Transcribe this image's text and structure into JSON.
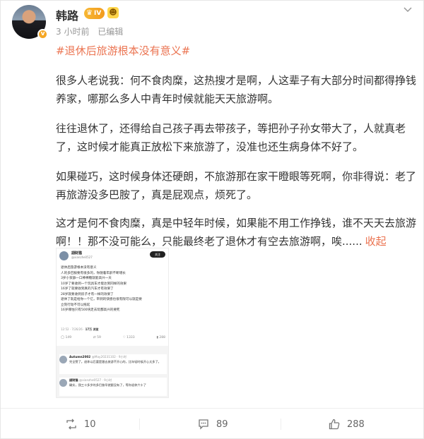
{
  "post": {
    "author": "韩路",
    "vip_level": "IV",
    "time": "3 小时前",
    "edited": "已编辑",
    "topic": "#退休后旅游根本没有意义#",
    "paragraphs": [
      "很多人老说我：何不食肉糜，这热搜才是啊，人这辈子有大部分时间都得挣钱养家，哪那么多人中青年时候就能天天旅游啊。",
      "往往退休了，还得给自己孩子再去带孩子，等把孙子孙女带大了，人就真老了，这时候才能真正放松下来旅游了，没准也还生病身体不好了。",
      "如果碰巧，这时候身体还硬朗，不旅游那在家干瞪眼等死啊，你非得说：老了再旅游没多巴胺了，真是屁观点，烦死了。",
      "这才是何不食肉糜，真是中轻年时候，如果能不用工作挣钱，谁不天天去旅游啊！！那不没可能么，只能最终老了退休才有空去旅游啊，唉......"
    ],
    "collapse_label": "收起"
  },
  "screenshot": {
    "name": "翃财猫",
    "handle": "@xianzhe0527",
    "follow": "关注",
    "lines": [
      "退休后旅游根本没有意义",
      "人的多巴胺要有很多的，你随着年龄不断增长",
      "3岁小孩舔一口棒棒糖就能高兴一天",
      "10岁了要收到一个玩具车才能达到同样的效果",
      "16岁了就要收到真的汽车才有效果了",
      "28岁就要收到房子才有一样的效果了",
      "退休了就是给你一个亿，带到的快感也很有限可以就是要",
      "立刻行动不可以拖延",
      "16岁哪怕只有500块走去玩都高兴的要死"
    ],
    "stats": "12:52 · 7/26/26",
    "views": "17万 浏览",
    "actions": [
      "149",
      "59",
      "1333",
      "288"
    ],
    "replies": [
      {
        "name": "Autumn2002",
        "handle": "@May20231102 · 9小时",
        "text": "完全赞了。退休以后要是跟去旅游不开心的，比年轻时候开心太多了。"
      },
      {
        "name": "翃财猫",
        "handle": "@xianzhe0527 · 9小时",
        "text": "确实，我三十多岁的多巴胺早就跟没有了，等你退休六十了"
      }
    ]
  },
  "footer": {
    "repost_count": "10",
    "comment_count": "89",
    "like_count": "288"
  },
  "colors": {
    "accent": "#eb7350",
    "vip": "#f29b1d",
    "text": "#333333",
    "muted": "#999999"
  }
}
